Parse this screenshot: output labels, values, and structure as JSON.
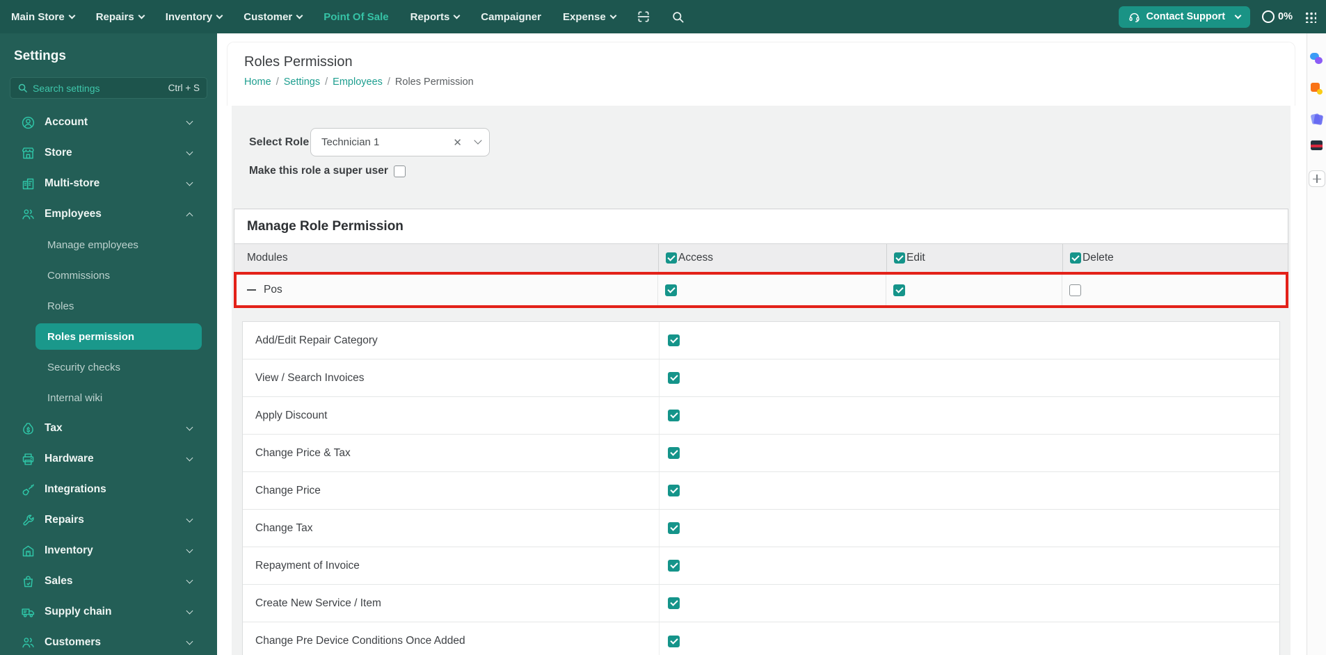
{
  "topnav": {
    "items": [
      {
        "label": "Main Store"
      },
      {
        "label": "Repairs"
      },
      {
        "label": "Inventory"
      },
      {
        "label": "Customer"
      },
      {
        "label": "Point Of Sale"
      },
      {
        "label": "Reports"
      },
      {
        "label": "Campaigner"
      },
      {
        "label": "Expense"
      }
    ],
    "contact_support": "Contact Support",
    "usage": "0%"
  },
  "sidebar": {
    "title": "Settings",
    "search_placeholder": "Search settings",
    "search_shortcut": "Ctrl + S",
    "items": [
      {
        "label": "Account"
      },
      {
        "label": "Store"
      },
      {
        "label": "Multi-store"
      },
      {
        "label": "Employees"
      },
      {
        "label": "Tax"
      },
      {
        "label": "Hardware"
      },
      {
        "label": "Integrations"
      },
      {
        "label": "Repairs"
      },
      {
        "label": "Inventory"
      },
      {
        "label": "Sales"
      },
      {
        "label": "Supply chain"
      },
      {
        "label": "Customers"
      }
    ],
    "children": [
      {
        "label": "Manage employees"
      },
      {
        "label": "Commissions"
      },
      {
        "label": "Roles"
      },
      {
        "label": "Roles permission",
        "selected": true
      },
      {
        "label": "Security checks"
      },
      {
        "label": "Internal wiki"
      }
    ]
  },
  "page": {
    "title": "Roles Permission",
    "breadcrumb": [
      "Home",
      "Settings",
      "Employees",
      "Roles Permission"
    ],
    "separator": "/"
  },
  "form": {
    "select_role_label": "Select Role",
    "selected_role": "Technician 1",
    "clear_glyph": "✕",
    "super_user_label": "Make this role a super user",
    "super_user_checked": false
  },
  "table": {
    "title": "Manage Role Permission",
    "modules_header": "Modules",
    "columns": [
      {
        "label": "Access",
        "checked": true
      },
      {
        "label": "Edit",
        "checked": true
      },
      {
        "label": "Delete",
        "checked": true
      }
    ],
    "module_row": {
      "label": "Pos",
      "access": true,
      "edit": true,
      "delete": false,
      "highlighted": true
    },
    "sub_rows": [
      {
        "label": "Add/Edit Repair Category",
        "access": true
      },
      {
        "label": "View / Search Invoices",
        "access": true
      },
      {
        "label": "Apply Discount",
        "access": true
      },
      {
        "label": "Change Price & Tax",
        "access": true
      },
      {
        "label": "Change Price",
        "access": true
      },
      {
        "label": "Change Tax",
        "access": true
      },
      {
        "label": "Repayment of Invoice",
        "access": true
      },
      {
        "label": "Create New Service / Item",
        "access": true
      },
      {
        "label": "Change Pre Device Conditions Once Added",
        "access": true
      }
    ]
  },
  "right_strip": {
    "icons": [
      "chat-icon",
      "orange-app-icon",
      "cards-icon",
      "book-icon",
      "add-icon"
    ]
  },
  "colors": {
    "nav_bg": "#1d564f",
    "sidebar_bg": "#235e56",
    "accent_teal": "#2fc5a7",
    "active_item_bg": "#1a988b",
    "support_button_bg": "#1a9385",
    "checkbox_teal": "#15948a",
    "highlight_red": "#e32119",
    "breadcrumb_link": "#1d9e8f"
  }
}
